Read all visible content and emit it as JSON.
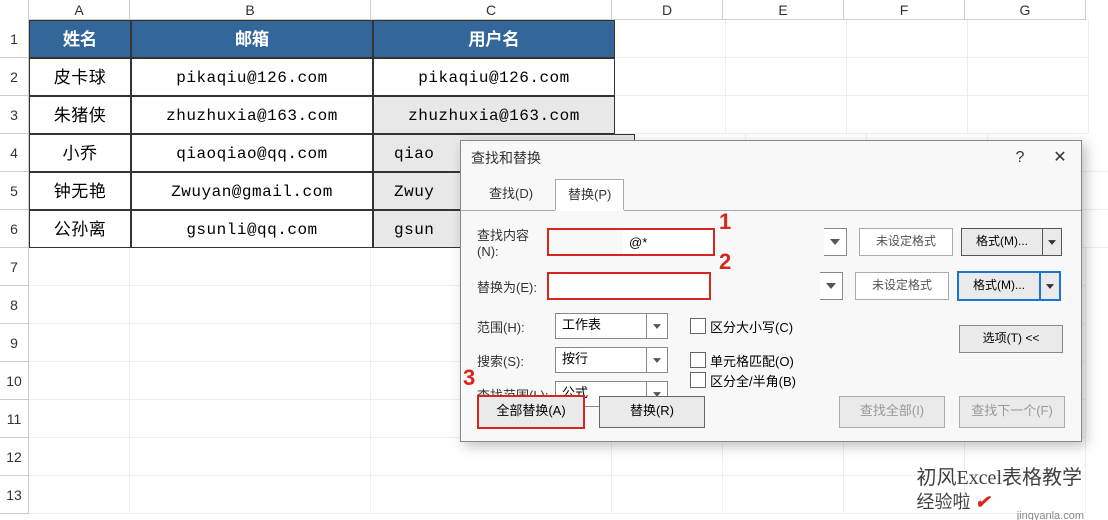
{
  "columns": [
    "A",
    "B",
    "C",
    "D",
    "E",
    "F",
    "G"
  ],
  "row_numbers": [
    "1",
    "2",
    "3",
    "4",
    "5",
    "6",
    "7",
    "8",
    "9",
    "10",
    "11",
    "12",
    "13"
  ],
  "table": {
    "headers": [
      "姓名",
      "邮箱",
      "用户名"
    ],
    "rows": [
      [
        "皮卡球",
        "pikaqiu@126.com",
        "pikaqiu@126.com"
      ],
      [
        "朱猪侠",
        "zhuzhuxia@163.com",
        "zhuzhuxia@163.com"
      ],
      [
        "小乔",
        "qiaoqiao@qq.com",
        "qiao"
      ],
      [
        "钟无艳",
        "Zwuyan@gmail.com",
        "Zwuy"
      ],
      [
        "公孙离",
        "gsunli@qq.com",
        "gsun"
      ]
    ]
  },
  "dialog": {
    "title": "查找和替换",
    "tabs": {
      "find": "查找(D)",
      "replace": "替换(P)"
    },
    "find_label": "查找内容(N):",
    "find_value": "@*",
    "replace_label": "替换为(E):",
    "replace_value": "",
    "no_format": "未设定格式",
    "format_btn": "格式(M)...",
    "scope_label": "范围(H):",
    "scope_value": "工作表",
    "search_label": "搜索(S):",
    "search_value": "按行",
    "lookin_label": "查找范围(L):",
    "lookin_value": "公式",
    "check1": "区分大小写(C)",
    "check2": "单元格匹配(O)",
    "check3": "区分全/半角(B)",
    "options_btn": "选项(T) <<",
    "btn_replace_all": "全部替换(A)",
    "btn_replace": "替换(R)",
    "btn_find_all": "查找全部(I)",
    "btn_find_next": "查找下一个(F)"
  },
  "annotations": {
    "one": "1",
    "two": "2",
    "three": "3"
  },
  "watermark": {
    "text": "初风Excel表格教学",
    "sub": "经验啦",
    "site": "jingyanla.com"
  }
}
